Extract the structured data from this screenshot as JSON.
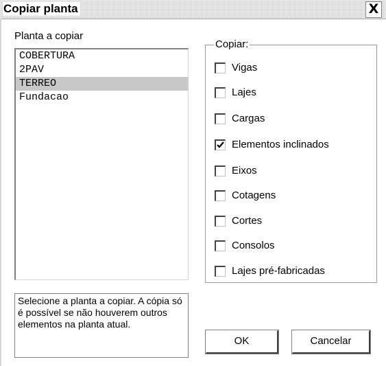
{
  "dialog": {
    "title": "Copiar planta",
    "close_glyph": "X"
  },
  "plant_list": {
    "label": "Planta a copiar",
    "items": [
      "COBERTURA",
      "2PAV",
      "TERREO",
      "Fundacao"
    ],
    "selected": "TERREO"
  },
  "copy_group": {
    "label": "Copiar:",
    "options": [
      {
        "label": "Vigas",
        "checked": false
      },
      {
        "label": "Lajes",
        "checked": false
      },
      {
        "label": "Cargas",
        "checked": false
      },
      {
        "label": "Elementos inclinados",
        "checked": true
      },
      {
        "label": "Eixos",
        "checked": false
      },
      {
        "label": "Cotagens",
        "checked": false
      },
      {
        "label": "Cortes",
        "checked": false
      },
      {
        "label": "Consolos",
        "checked": false
      },
      {
        "label": "Lajes pré-fabricadas",
        "checked": false
      }
    ]
  },
  "help_text": "Selecione a planta a copiar. A cópia só é possível se não houverem outros elementos na planta atual.",
  "buttons": {
    "ok": "OK",
    "cancel": "Cancelar"
  }
}
